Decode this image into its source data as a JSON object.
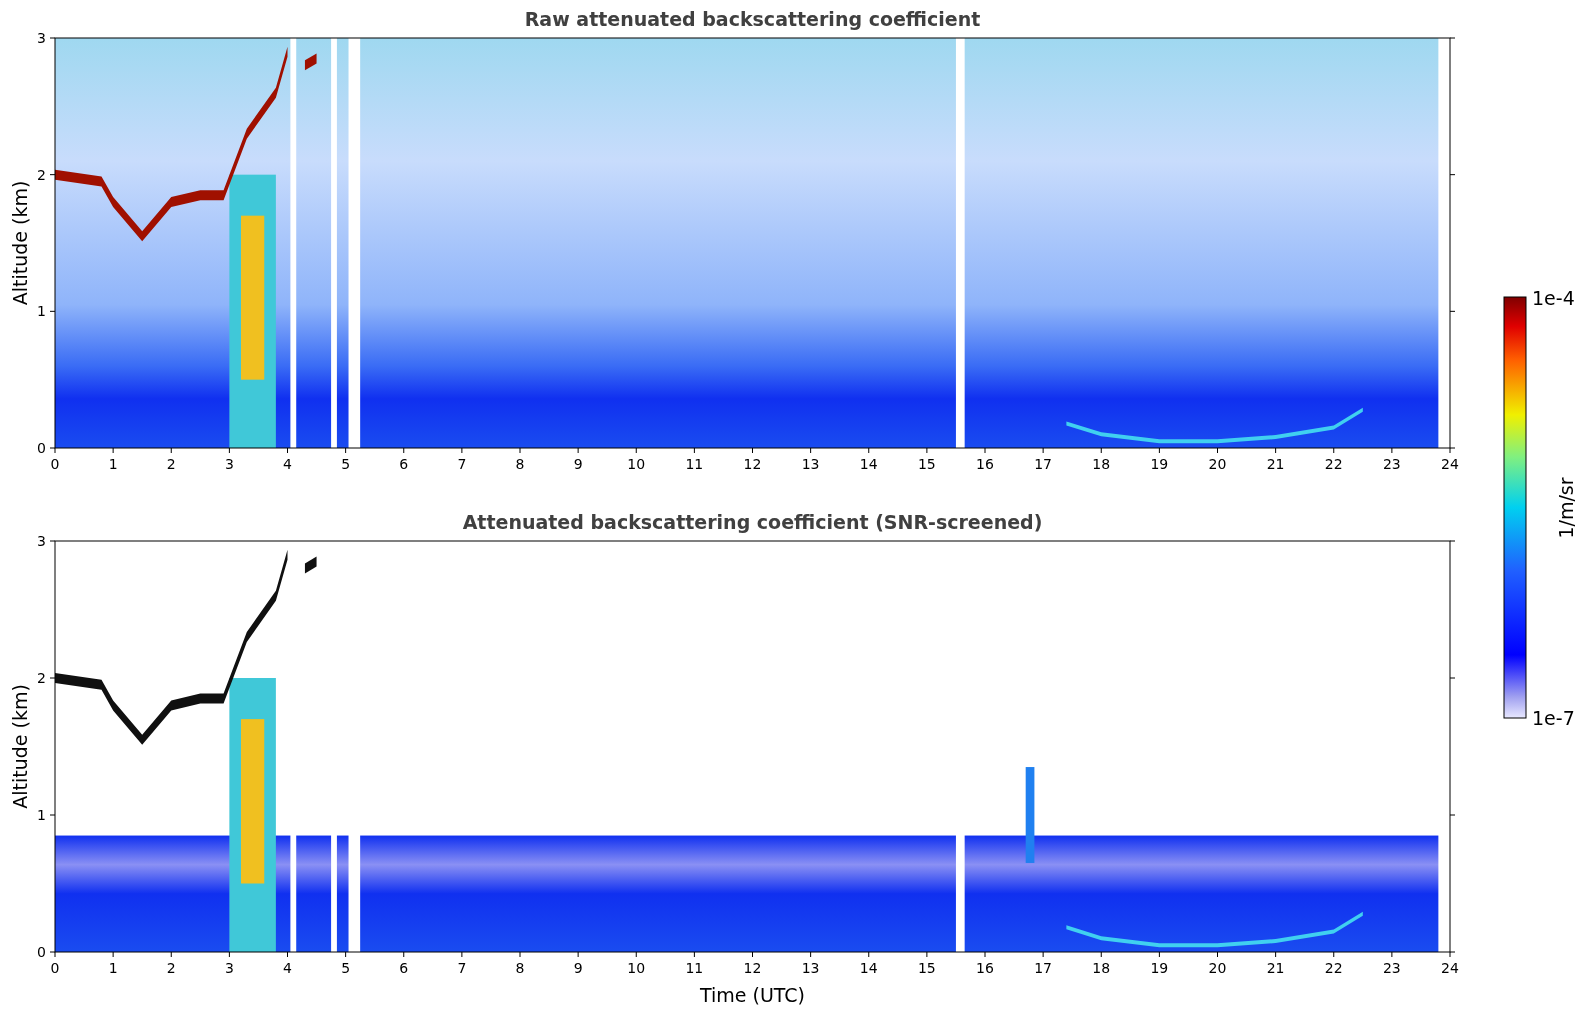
{
  "panels": [
    {
      "title": "Raw attenuated backscattering coefficient",
      "ylabel": "Altitude (km)",
      "kind": "raw",
      "yticks": [
        "3",
        "2",
        "1",
        "0"
      ],
      "xticks": [
        "0",
        "1",
        "2",
        "3",
        "4",
        "5",
        "6",
        "7",
        "8",
        "9",
        "10",
        "11",
        "12",
        "13",
        "14",
        "15",
        "16",
        "17",
        "18",
        "19",
        "20",
        "21",
        "22",
        "23",
        "24"
      ]
    },
    {
      "title": "Attenuated backscattering coefficient (SNR-screened)",
      "ylabel": "Altitude (km)",
      "kind": "screened",
      "yticks": [
        "3",
        "2",
        "1",
        "0"
      ],
      "xticks": [
        "0",
        "1",
        "2",
        "3",
        "4",
        "5",
        "6",
        "7",
        "8",
        "9",
        "10",
        "11",
        "12",
        "13",
        "14",
        "15",
        "16",
        "17",
        "18",
        "19",
        "20",
        "21",
        "22",
        "23",
        "24"
      ],
      "xlabel": "Time (UTC)"
    }
  ],
  "colorbar": {
    "max_label": "1e-4",
    "min_label": "1e-7",
    "unit": "1/m/sr"
  }
}
